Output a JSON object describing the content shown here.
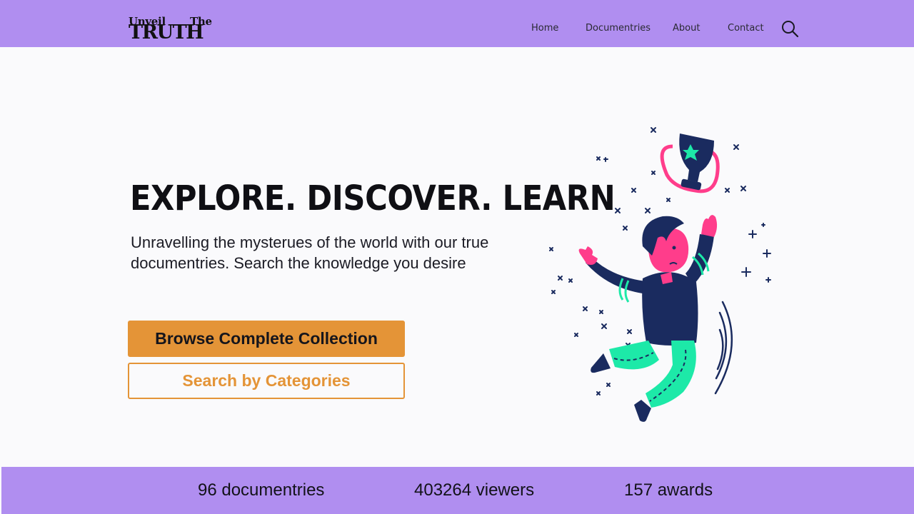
{
  "brand": {
    "line1_left": "Unveil",
    "line1_right": "The",
    "line2": "TRUTH",
    "line2_big_letter": "T"
  },
  "nav": {
    "items": [
      {
        "label": "Home"
      },
      {
        "label": "Documentries"
      },
      {
        "label": "About"
      },
      {
        "label": "Contact"
      }
    ],
    "search_icon": "search-icon"
  },
  "hero": {
    "title": "EXPLORE. DISCOVER. LEARN",
    "subtitle": "Unravelling the mysterues of the world with our true documentries. Search the knowledge you desire",
    "primary_button": "Browse Complete Collection",
    "secondary_button": "Search by Categories",
    "illustration_icon": "jumping-person-with-trophy-illustration"
  },
  "stats": [
    {
      "label": "96 documentries"
    },
    {
      "label": "403264 viewers"
    },
    {
      "label": "157 awards"
    }
  ],
  "colors": {
    "nav_bg": "#b08ef0",
    "accent": "#e49437",
    "page_bg": "#fafafc",
    "text_dark": "#0f0f14",
    "illustration_navy": "#1a2b5f",
    "illustration_pink": "#ff3d8b",
    "illustration_mint": "#1de9a8"
  }
}
